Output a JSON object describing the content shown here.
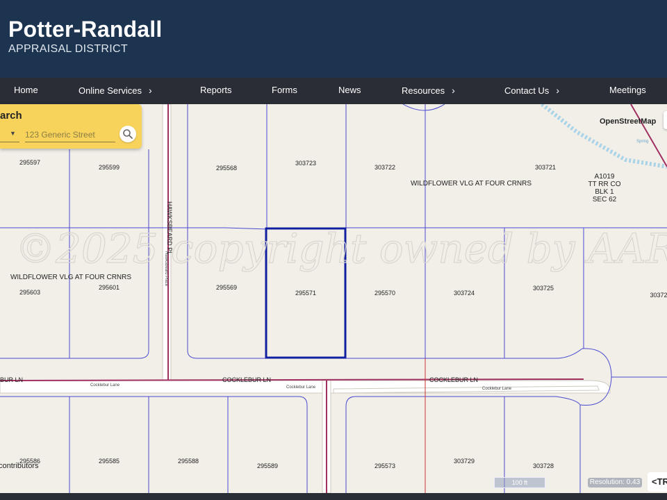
{
  "header": {
    "title": "Potter-Randall",
    "subtitle": "APPRAISAL DISTRICT"
  },
  "nav": {
    "items": [
      {
        "label": "Home"
      },
      {
        "label": "Online Services"
      },
      {
        "label": "Reports"
      },
      {
        "label": "Forms"
      },
      {
        "label": "News"
      },
      {
        "label": "Resources"
      },
      {
        "label": "Contact Us"
      },
      {
        "label": "Meetings"
      }
    ],
    "chevron": "›"
  },
  "search": {
    "title_fragment": "arch",
    "placeholder": "123 Generic Street"
  },
  "map": {
    "watermark": "©2025 copyright owned by AAR",
    "layer_label": "OpenStreetMap",
    "parcels": {
      "p295597": "295597",
      "p295599": "295599",
      "p295568": "295568",
      "p303723": "303723",
      "p303722": "303722",
      "p303721": "303721",
      "p295603": "295603",
      "p295601": "295601",
      "p295569": "295569",
      "p295571": "295571",
      "p295570": "295570",
      "p303724": "303724",
      "p303725": "303725",
      "p30372x": "30372",
      "p295586": "295586",
      "p295585": "295585",
      "p295588": "295588",
      "p295589": "295589",
      "p295573": "295573",
      "p303729": "303729",
      "p303728": "303728"
    },
    "subdivision_labels": {
      "wildflower_top": "WILDFLOWER VLG AT FOUR CRNRS",
      "wildflower_left": "WILDFLOWER VLG AT FOUR CRNRS"
    },
    "survey_block": {
      "line1": "A1019",
      "line2": "TT RR CO",
      "line3": "BLK 1",
      "line4": "SEC 62"
    },
    "streets": {
      "hawksbeard_upper": "HAWKSBEARD PL",
      "hawksbeard_osm": "Hawksbeard Place",
      "cocklebur_left": "BUR LN",
      "cocklebur_mid": "COCKLEBUR LN",
      "cocklebur_right": "COCKLEBUR LN",
      "cocklebur_osm_1": "Cocklebur Lane",
      "cocklebur_osm_2": "Cocklebur Lane",
      "cocklebur_osm_3": "Cocklebur Lane",
      "spring": "Spring"
    },
    "attribution": "contributors",
    "scale": "100 ft",
    "resolution": "Resolution: 0.43",
    "toggle": "<TR"
  },
  "colors": {
    "header": "#1d3450",
    "nav": "#2a2d36",
    "search": "#f7d35c",
    "parcel_line": "#4a4ad0",
    "selected": "#1020a0",
    "road": "#a03060"
  }
}
